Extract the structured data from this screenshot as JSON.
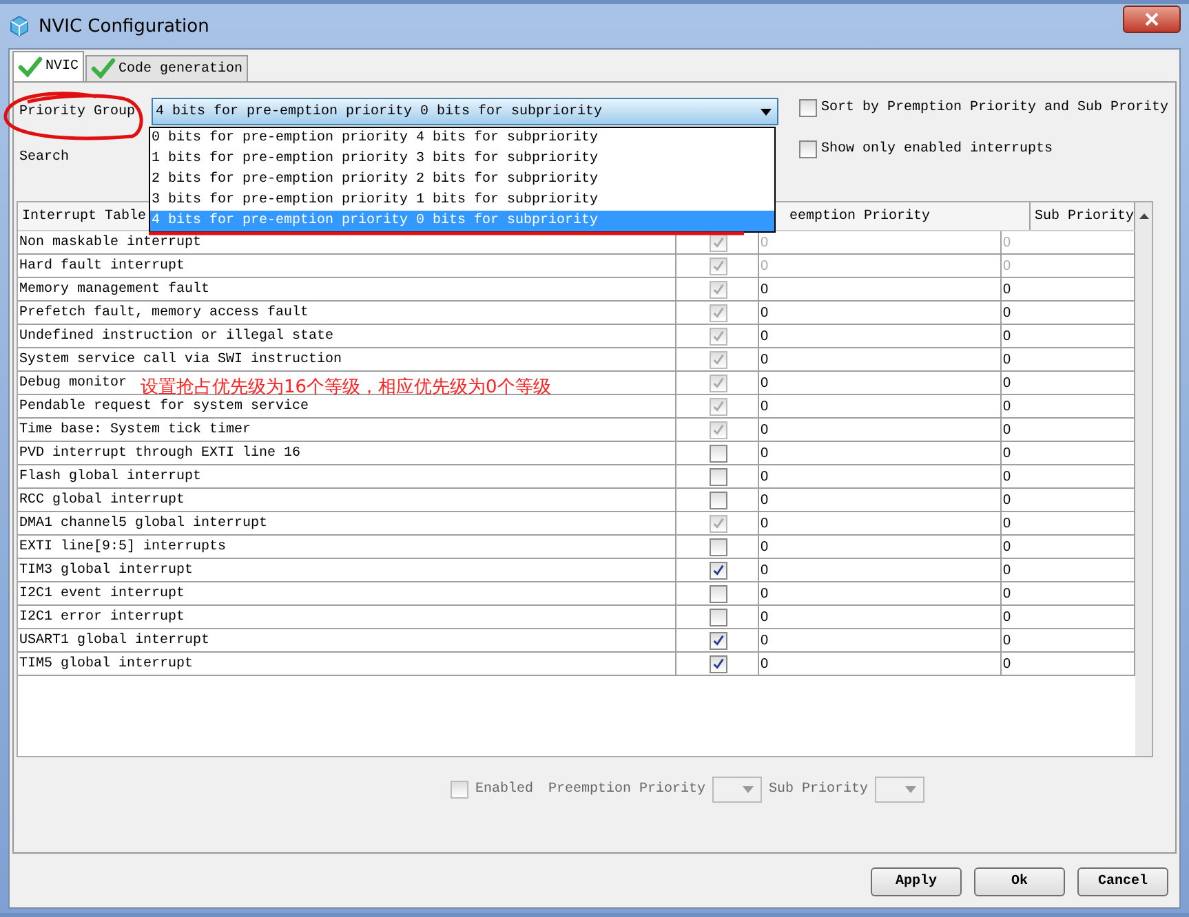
{
  "window": {
    "title": "NVIC Configuration"
  },
  "tabs": [
    {
      "label": "NVIC",
      "selected": true
    },
    {
      "label": "Code generation",
      "selected": false
    }
  ],
  "priority_group": {
    "label": "Priority Group",
    "value": "4 bits for pre-emption priority 0 bits for subpriority",
    "expanded": true,
    "options": [
      {
        "label": "0 bits for pre-emption priority 4 bits for subpriority",
        "selected": false
      },
      {
        "label": "1 bits for pre-emption priority 3 bits for subpriority",
        "selected": false
      },
      {
        "label": "2 bits for pre-emption priority 2 bits for subpriority",
        "selected": false
      },
      {
        "label": "3 bits for pre-emption priority 1 bits for subpriority",
        "selected": false
      },
      {
        "label": "4 bits for pre-emption priority 0 bits for subpriority",
        "selected": true
      }
    ]
  },
  "search": {
    "label": "Search"
  },
  "options": [
    {
      "label": "Sort by Premption Priority and Sub Prority",
      "checked": false
    },
    {
      "label": "Show only enabled interrupts",
      "checked": false
    }
  ],
  "table": {
    "columns": [
      "Interrupt Table",
      "eemption Priority",
      "Sub Priority"
    ],
    "rows": [
      {
        "name": "Non maskable interrupt",
        "enabled": true,
        "disabled": true,
        "preemption": "0",
        "sub": "0"
      },
      {
        "name": "Hard fault interrupt",
        "enabled": true,
        "disabled": true,
        "preemption": "0",
        "sub": "0"
      },
      {
        "name": "Memory management fault",
        "enabled": true,
        "disabled": true,
        "preemption": "0",
        "sub": "0"
      },
      {
        "name": "Prefetch fault, memory access fault",
        "enabled": true,
        "disabled": true,
        "preemption": "0",
        "sub": "0"
      },
      {
        "name": "Undefined instruction or illegal state",
        "enabled": true,
        "disabled": true,
        "preemption": "0",
        "sub": "0"
      },
      {
        "name": "System service call via SWI instruction",
        "enabled": true,
        "disabled": true,
        "preemption": "0",
        "sub": "0"
      },
      {
        "name": "Debug monitor",
        "enabled": true,
        "disabled": true,
        "preemption": "0",
        "sub": "0"
      },
      {
        "name": "Pendable request for system service",
        "enabled": true,
        "disabled": true,
        "preemption": "0",
        "sub": "0"
      },
      {
        "name": "Time base: System tick timer",
        "enabled": true,
        "disabled": true,
        "preemption": "0",
        "sub": "0"
      },
      {
        "name": "PVD interrupt through EXTI line 16",
        "enabled": false,
        "disabled": false,
        "preemption": "0",
        "sub": "0"
      },
      {
        "name": "Flash global interrupt",
        "enabled": false,
        "disabled": false,
        "preemption": "0",
        "sub": "0"
      },
      {
        "name": "RCC global interrupt",
        "enabled": false,
        "disabled": false,
        "preemption": "0",
        "sub": "0"
      },
      {
        "name": "DMA1 channel5 global interrupt",
        "enabled": true,
        "disabled": true,
        "preemption": "0",
        "sub": "0"
      },
      {
        "name": "EXTI line[9:5] interrupts",
        "enabled": false,
        "disabled": false,
        "preemption": "0",
        "sub": "0"
      },
      {
        "name": "TIM3 global interrupt",
        "enabled": true,
        "disabled": false,
        "preemption": "0",
        "sub": "0"
      },
      {
        "name": "I2C1 event interrupt",
        "enabled": false,
        "disabled": false,
        "preemption": "0",
        "sub": "0"
      },
      {
        "name": "I2C1 error interrupt",
        "enabled": false,
        "disabled": false,
        "preemption": "0",
        "sub": "0"
      },
      {
        "name": "USART1 global interrupt",
        "enabled": true,
        "disabled": false,
        "preemption": "0",
        "sub": "0"
      },
      {
        "name": "TIM5 global interrupt",
        "enabled": true,
        "disabled": false,
        "preemption": "0",
        "sub": "0"
      }
    ]
  },
  "detail": {
    "enabled": false,
    "enabled_label": "Enabled",
    "preemption_label": "Preemption Priority",
    "sub_label": "Sub Priority"
  },
  "buttons": [
    "Apply",
    "Ok",
    "Cancel"
  ],
  "annotation": {
    "text": "设置抢占优先级为16个等级，相应优先级为0个等级"
  }
}
